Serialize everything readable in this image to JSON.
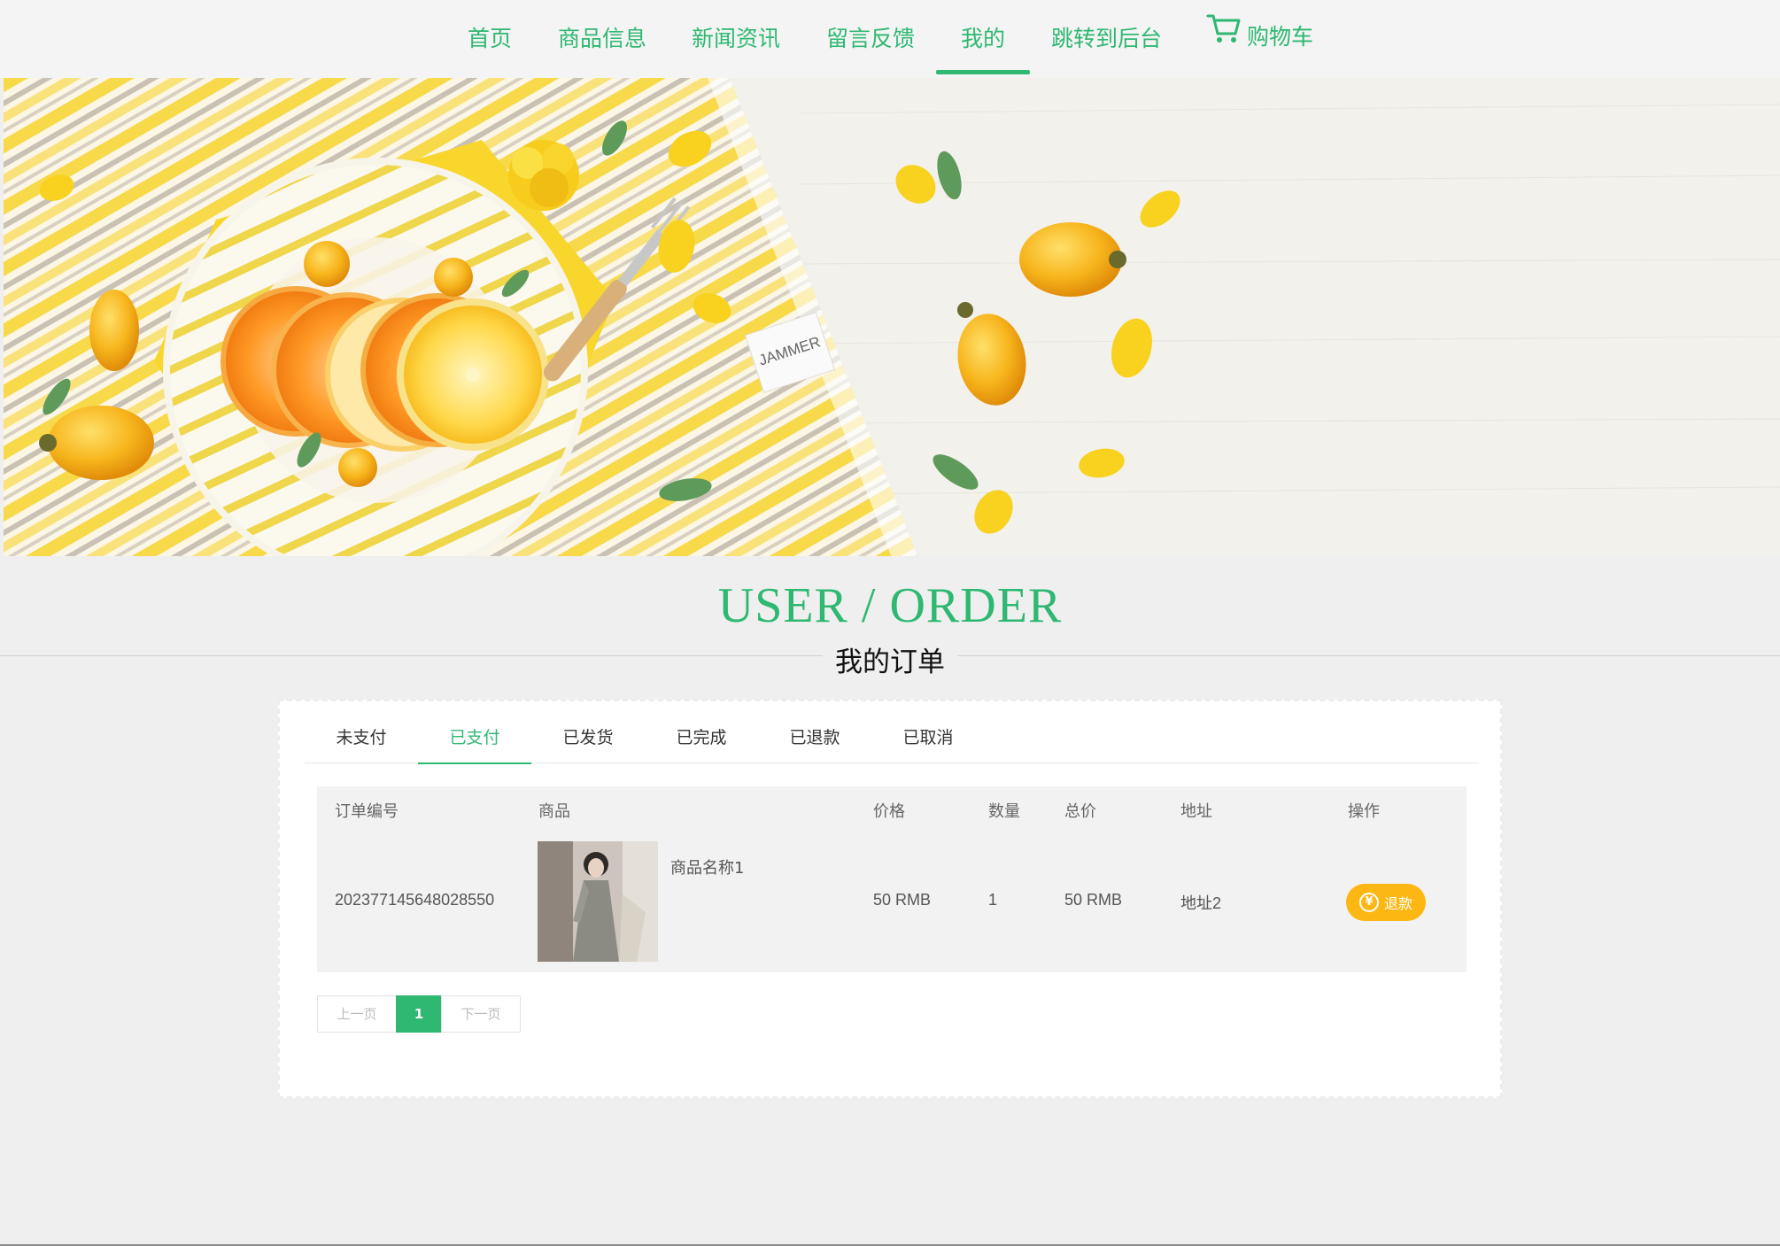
{
  "nav": {
    "items": [
      {
        "label": "首页"
      },
      {
        "label": "商品信息"
      },
      {
        "label": "新闻资讯"
      },
      {
        "label": "留言反馈"
      },
      {
        "label": "我的",
        "active": true
      },
      {
        "label": "跳转到后台"
      }
    ],
    "cart_label": "购物车",
    "cart_icon": "cart-icon"
  },
  "banner": {
    "label_text": "JAMMER"
  },
  "heading": {
    "title_en": "USER / ORDER",
    "title_cn": "我的订单"
  },
  "tabs": [
    {
      "label": "未支付"
    },
    {
      "label": "已支付",
      "active": true
    },
    {
      "label": "已发货"
    },
    {
      "label": "已完成"
    },
    {
      "label": "已退款"
    },
    {
      "label": "已取消"
    }
  ],
  "table": {
    "headers": {
      "order_no": "订单编号",
      "product": "商品",
      "price": "价格",
      "qty": "数量",
      "total": "总价",
      "address": "地址",
      "action": "操作"
    },
    "rows": [
      {
        "order_no": "202377145648028550",
        "product_name": "商品名称1",
        "price": "50 RMB",
        "qty": "1",
        "total": "50 RMB",
        "address": "地址2",
        "action_label": "退款",
        "action_icon": "yen-icon",
        "action_icon_glyph": "¥"
      }
    ]
  },
  "pagination": {
    "prev": "上一页",
    "current": "1",
    "next": "下一页"
  },
  "colors": {
    "accent": "#2eb872",
    "refund": "#fdb713",
    "background": "#efefef"
  }
}
